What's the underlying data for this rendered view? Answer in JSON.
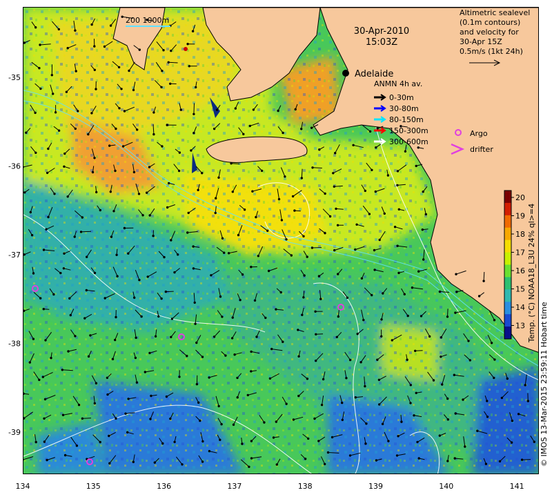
{
  "map": {
    "date_title": "30-Apr-2010",
    "time_title": "15:03Z",
    "place_label": "Adelaide",
    "scale_bar_label": "200  1000m",
    "altimetry_note": [
      "Altimetric sealevel",
      "(0.1m contours)",
      "and velocity for",
      "30-Apr 15Z",
      "0.5m/s (1kt 24h)"
    ],
    "anmn_title": "ANMN 4h av.",
    "depth_legend": [
      {
        "label": "0-30m",
        "color": "#000000"
      },
      {
        "label": "30-80m",
        "color": "#0000ff"
      },
      {
        "label": "80-150m",
        "color": "#00e5ff"
      },
      {
        "label": "150-300m",
        "color": "#ff0000"
      },
      {
        "label": "300-600m",
        "color": "#ffffff"
      }
    ],
    "symbol_legend": {
      "argo": "Argo",
      "drifter": "drifter"
    },
    "colorbar": {
      "title": "Temp. (°C) NOAA18_L3U 24% ql>=4",
      "ticks": [
        "20",
        "19",
        "18",
        "17",
        "16",
        "15",
        "14",
        "13"
      ],
      "colors": [
        "#7a0000",
        "#d21e00",
        "#f06a00",
        "#f7a800",
        "#f5dd00",
        "#c8f000",
        "#6ae030",
        "#2cc070",
        "#30b8b0",
        "#2a8ee0",
        "#1a4ad0",
        "#08108a"
      ]
    },
    "credit": "© IMOS 13-Mar-2015 23:59:11 Hobart time",
    "x_ticks": [
      "134",
      "135",
      "136",
      "137",
      "138",
      "139",
      "140",
      "141"
    ],
    "y_ticks": [
      "-35",
      "-36",
      "-37",
      "-38",
      "-39"
    ],
    "colors": {
      "land": "#f7c89c",
      "argo": "#e040e0",
      "contour": "#ffffff"
    }
  }
}
